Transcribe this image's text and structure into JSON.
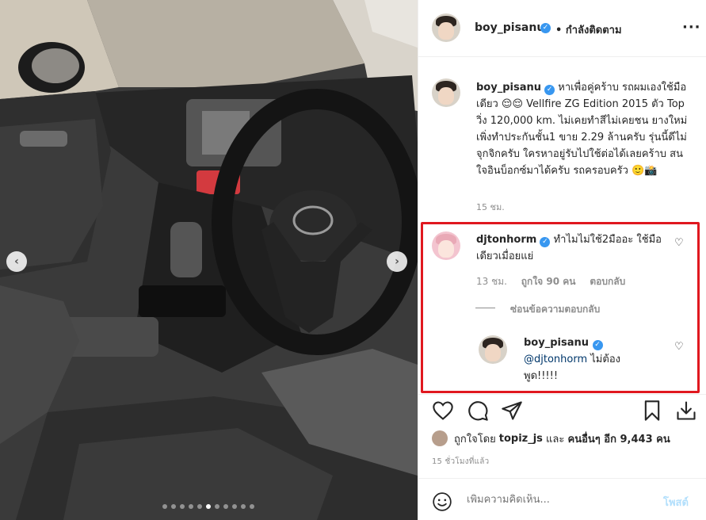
{
  "post": {
    "username": "boy_pisanu",
    "follow_status": "• กำลังติดตาม",
    "more_icon": "more-dots-icon",
    "caption": "หาเพื่อคู่คร้าบ รถผมเองใช้มือเดียว 😌😌 Vellfire ZG Edition 2015 ตัว Top วิ่ง 120,000 km. ไม่เคยทำสีไม่เคยชน ยางใหม่ เพิ่งทำประกันชั้น1 ขาย 2.29 ล้านครับ รุ่นนี้ดีไม่จุกจิกครับ ใครหาอยู่รับไปใช้ต่อได้เลยคร้าบ สนใจอินบ็อกซ์มาได้ครับ รถครอบครัว 🙂📸",
    "caption_time": "15 ชม."
  },
  "comments": [
    {
      "username": "djtonhorm",
      "text": "ทำไมไม่ใช้2มืออะ ใช้มือเดียวเมื่อยแย่",
      "time": "13 ชม.",
      "likes": "ถูกใจ 90 คน",
      "reply_label": "ตอบกลับ",
      "hide_replies": "ซ่อนข้อความตอบกลับ",
      "replies": [
        {
          "username": "boy_pisanu",
          "mention": "@djtonhorm",
          "text": " ไม่ต้องพูด!!!!!"
        }
      ]
    }
  ],
  "liked_by": {
    "prefix": "ถูกใจโดย ",
    "user": "topiz_js",
    "middle": " และ ",
    "others": "คนอื่นๆ อีก 9,443 คน"
  },
  "posted_ago": "15 ชั่วโมงที่แล้ว",
  "comment_box": {
    "placeholder": "เพิ่มความคิดเห็น...",
    "post_label": "โพสต์"
  },
  "carousel": {
    "prev_label": "‹",
    "next_label": "›",
    "dot_count": 11,
    "active_index": 5
  },
  "colors": {
    "highlight": "#e0181f",
    "verified": "#3897f0",
    "mention": "#00376b",
    "post_disabled": "#b2dffc"
  }
}
